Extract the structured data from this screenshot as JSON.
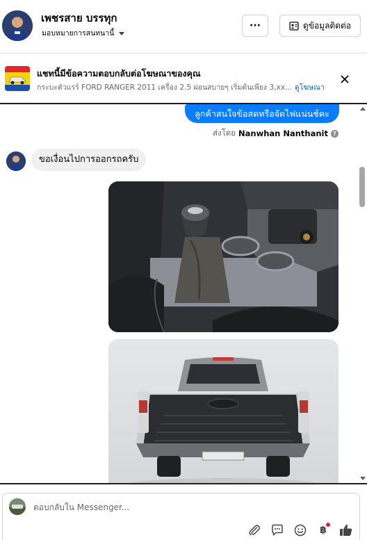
{
  "header": {
    "name": "เพชรสาย บรรทุก",
    "subtitle": "มอบหมายการสนทนานี้",
    "more_label": "···",
    "contact_label": "ดูข้อมูลติดต่อ"
  },
  "ad": {
    "title": "แชทนี้มีข้อความตอบกลับต่อโฆษณาของคุณ",
    "description": "กระบะตัวแรร์ FORD RANGER 2011 เครื่อง 2.5 ผ่อนสบายๆ เริ่มต้นเพียง 3,xx...",
    "link": "ดูโฆษณา"
  },
  "messages": {
    "outgoing_text": "ลูกค้าสนใจข้อสดหรือจัดไฟแน่นช์คะ",
    "sent_by_prefix": "ส่งโดย",
    "sent_by_name": "Nanwhan Nanthanit",
    "help_glyph": "?",
    "incoming_text": "ขอเงื่อนไปการออกรถครับ"
  },
  "composer": {
    "placeholder": "ตอบกลับใน Messenger...",
    "baht_glyph": "฿"
  },
  "icons": {
    "more": "more-dots-icon",
    "contact": "contact-card-icon",
    "close": "close-icon",
    "attach": "paperclip-icon",
    "saved_reply": "saved-reply-icon",
    "emoji": "emoji-icon",
    "payment": "baht-icon",
    "like": "thumbs-up-icon"
  }
}
